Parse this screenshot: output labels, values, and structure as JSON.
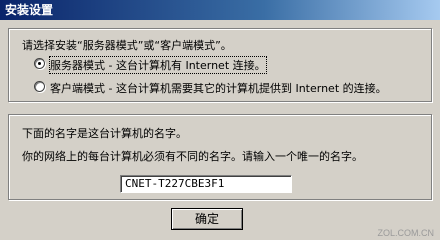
{
  "window": {
    "title": "安装设置"
  },
  "mode_group": {
    "prompt": "请选择安装“服务器模式”或“客户端模式”。",
    "options": [
      {
        "label": "服务器模式 - 这台计算机有 Internet 连接。",
        "selected": true
      },
      {
        "label": "客户端模式 - 这台计算机需要其它的计算机提供到 Internet 的连接。",
        "selected": false
      }
    ]
  },
  "name_group": {
    "line1": "下面的名字是这台计算机的名字。",
    "line2": "你的网络上的每台计算机必须有不同的名字。请输入一个唯一的名字。",
    "name_value": "CNET-T227CBE3F1"
  },
  "ok_label": "确定",
  "watermark": "ZOL.COM.CN"
}
